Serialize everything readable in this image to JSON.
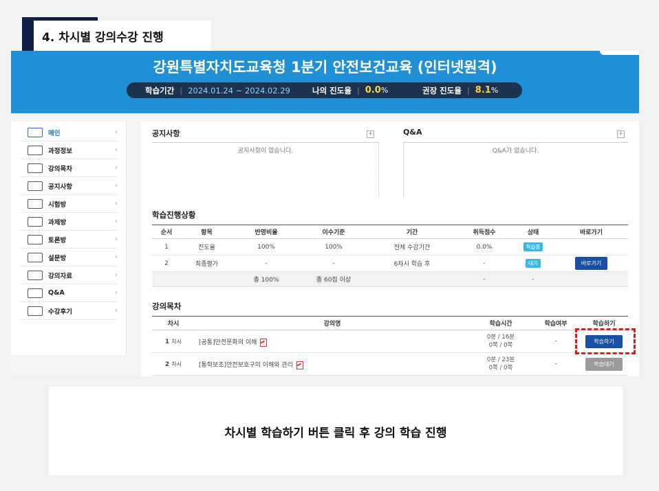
{
  "step": {
    "title": "4. 차시별 강의수강 진행"
  },
  "banner": {
    "title": "강원특별자치도교육청 1분기 안전보건교육 (인터넷원격)",
    "period_label": "학습기간",
    "period_value": "2024.01.24 ~ 2024.02.29",
    "my_progress_label": "나의 진도율",
    "my_progress_value": "0.0",
    "recommended_label": "권장 진도율",
    "recommended_value": "8.1",
    "percent_sign": "%"
  },
  "sidebar": {
    "items": [
      {
        "label": "메인",
        "icon": "home-icon"
      },
      {
        "label": "과정정보",
        "icon": "laptop-icon"
      },
      {
        "label": "강의목차",
        "icon": "list-icon"
      },
      {
        "label": "공지사항",
        "icon": "megaphone-icon"
      },
      {
        "label": "시험방",
        "icon": "pencil-icon"
      },
      {
        "label": "과제방",
        "icon": "document-icon"
      },
      {
        "label": "토론방",
        "icon": "chat-icon"
      },
      {
        "label": "설문방",
        "icon": "survey-icon"
      },
      {
        "label": "강의자료",
        "icon": "books-icon"
      },
      {
        "label": "Q&A",
        "icon": "qa-icon"
      },
      {
        "label": "수강후기",
        "icon": "review-icon"
      }
    ]
  },
  "notice": {
    "title": "공지사항",
    "empty": "공지사항이 없습니다."
  },
  "qna": {
    "title": "Q&A",
    "empty": "Q&A가 없습니다."
  },
  "progress": {
    "title": "학습진행상황",
    "headers": [
      "순서",
      "항목",
      "반영비율",
      "이수기준",
      "기간",
      "취득점수",
      "상태",
      "바로가기"
    ],
    "rows": [
      {
        "order": "1",
        "item": "진도율",
        "ratio": "100%",
        "criteria": "100%",
        "period": "전체 수강기간",
        "score": "0.0%",
        "status": "학습중",
        "goto": ""
      },
      {
        "order": "2",
        "item": "최종평가",
        "ratio": "-",
        "criteria": "-",
        "period": "6차시 학습 후",
        "score": "-",
        "status": "대기",
        "goto": "바로가기"
      }
    ],
    "total": {
      "ratio": "총 100%",
      "criteria": "총 60점 이상",
      "score": "-",
      "status": "-"
    }
  },
  "lectures": {
    "title": "강의목차",
    "headers": [
      "차시",
      "강의명",
      "학습시간",
      "학습여부",
      "학습하기"
    ],
    "rows": [
      {
        "num": "1",
        "unit": "차시",
        "title": "[공통]안전문화의 이해",
        "time": "0분 / 16분",
        "pages": "0쪽 / 0쪽",
        "done": "-",
        "action": "학습하기"
      },
      {
        "num": "2",
        "unit": "차시",
        "title": "[통학보조]안전보호구의 이해와 관리",
        "time": "0분 / 23분",
        "pages": "0쪽 / 0쪽",
        "done": "-",
        "action": "학습대기"
      }
    ]
  },
  "caption": "차시별 학습하기 버튼 클릭 후 강의 학습 진행"
}
